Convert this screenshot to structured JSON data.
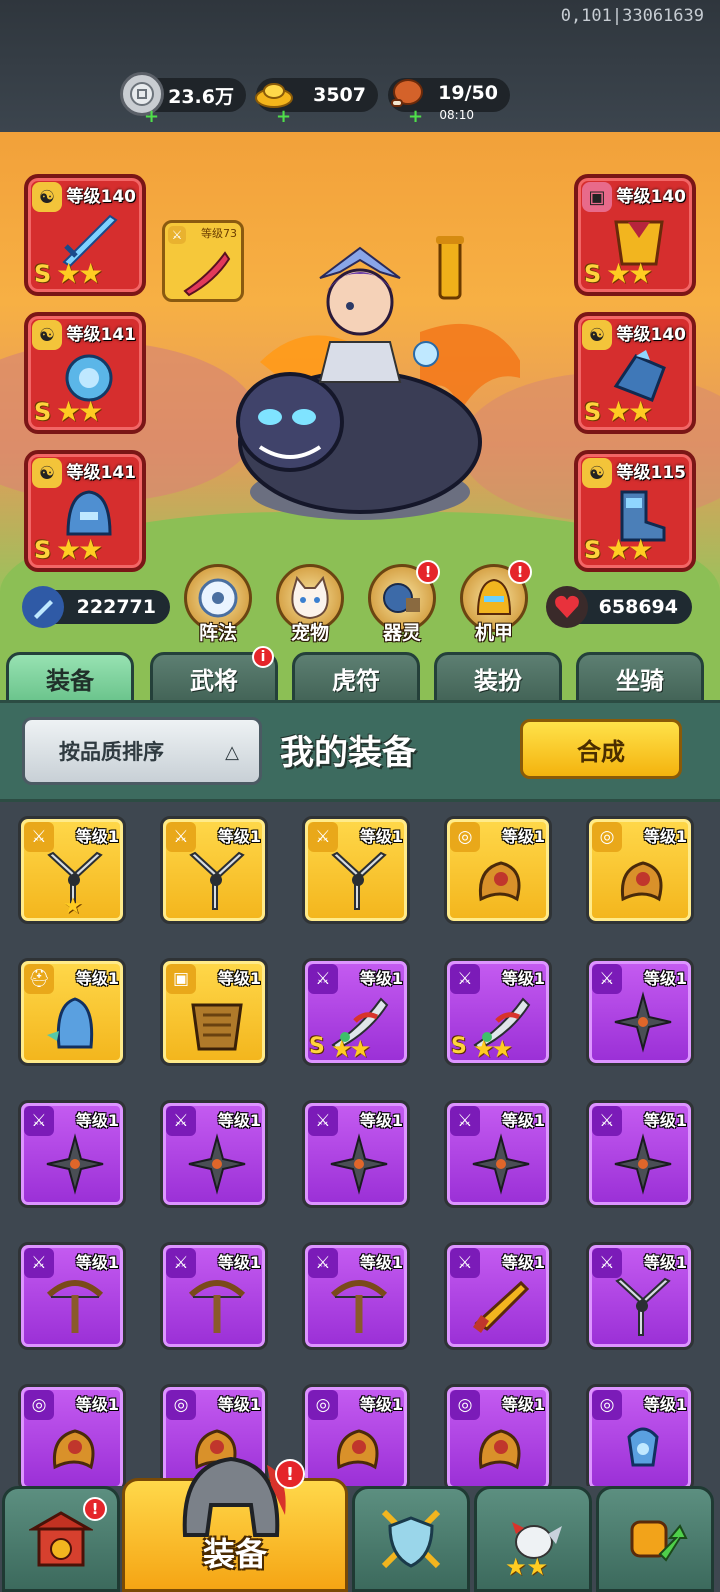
{
  "debug_id": "0,101|33061639",
  "resources": {
    "silver": {
      "value": "23.6万"
    },
    "gold": {
      "value": "3507"
    },
    "stamina": {
      "value": "19/50",
      "timer": "08:10"
    }
  },
  "hero_slots": {
    "left": [
      {
        "level": "等级140",
        "grade": "S",
        "stars": "★★"
      },
      {
        "level": "等级141",
        "grade": "S",
        "stars": "★★"
      },
      {
        "level": "等级141",
        "grade": "S",
        "stars": "★★"
      }
    ],
    "right": [
      {
        "level": "等级140",
        "grade": "S",
        "stars": "★★"
      },
      {
        "level": "等级140",
        "grade": "S",
        "stars": "★★"
      },
      {
        "level": "等级115",
        "grade": "S",
        "stars": "★★"
      }
    ],
    "linked_weapon": {
      "level": "等级73"
    }
  },
  "attack_power": "222771",
  "health_power": "658694",
  "features": [
    {
      "label": "阵法",
      "alert": false
    },
    {
      "label": "宠物",
      "alert": false
    },
    {
      "label": "器灵",
      "alert": true
    },
    {
      "label": "机甲",
      "alert": true
    }
  ],
  "tabs": [
    {
      "label": "装备",
      "active": true
    },
    {
      "label": "武将",
      "alert": true
    },
    {
      "label": "虎符"
    },
    {
      "label": "装扮"
    },
    {
      "label": "坐骑"
    }
  ],
  "panel": {
    "sort_label": "按品质排序",
    "title": "我的装备",
    "compose_label": "合成"
  },
  "inventory": [
    {
      "rarity": "gold",
      "type": "weapon",
      "item": "shuriken-blade",
      "level": "等级1",
      "stars": "★"
    },
    {
      "rarity": "gold",
      "type": "weapon",
      "item": "shuriken-blade",
      "level": "等级1"
    },
    {
      "rarity": "gold",
      "type": "weapon",
      "item": "shuriken-blade",
      "level": "等级1"
    },
    {
      "rarity": "gold",
      "type": "medal",
      "item": "amulet",
      "level": "等级1"
    },
    {
      "rarity": "gold",
      "type": "medal",
      "item": "amulet",
      "level": "等级1"
    },
    {
      "rarity": "gold",
      "type": "helmet",
      "item": "blue-helmet",
      "level": "等级1"
    },
    {
      "rarity": "gold",
      "type": "armor",
      "item": "bronze-armor",
      "level": "等级1"
    },
    {
      "rarity": "purple",
      "type": "weapon",
      "item": "dragon-blade",
      "level": "等级1",
      "grade": "S",
      "stars": "★★"
    },
    {
      "rarity": "purple",
      "type": "weapon",
      "item": "dragon-blade",
      "level": "等级1",
      "grade": "S",
      "stars": "★★"
    },
    {
      "rarity": "purple",
      "type": "weapon",
      "item": "ninja-star",
      "level": "等级1"
    },
    {
      "rarity": "purple",
      "type": "weapon",
      "item": "ninja-star",
      "level": "等级1"
    },
    {
      "rarity": "purple",
      "type": "weapon",
      "item": "ninja-star",
      "level": "等级1"
    },
    {
      "rarity": "purple",
      "type": "weapon",
      "item": "ninja-star",
      "level": "等级1"
    },
    {
      "rarity": "purple",
      "type": "weapon",
      "item": "ninja-star",
      "level": "等级1"
    },
    {
      "rarity": "purple",
      "type": "weapon",
      "item": "ninja-star",
      "level": "等级1"
    },
    {
      "rarity": "purple",
      "type": "weapon",
      "item": "crossbow",
      "level": "等级1"
    },
    {
      "rarity": "purple",
      "type": "weapon",
      "item": "crossbow",
      "level": "等级1"
    },
    {
      "rarity": "purple",
      "type": "weapon",
      "item": "crossbow",
      "level": "等级1"
    },
    {
      "rarity": "purple",
      "type": "weapon",
      "item": "golden-gun",
      "level": "等级1"
    },
    {
      "rarity": "purple",
      "type": "weapon",
      "item": "shuriken-blade",
      "level": "等级1"
    },
    {
      "rarity": "purple",
      "type": "medal",
      "item": "amulet",
      "level": "等级1"
    },
    {
      "rarity": "purple",
      "type": "medal",
      "item": "amulet",
      "level": "等级1"
    },
    {
      "rarity": "purple",
      "type": "medal",
      "item": "amulet",
      "level": "等级1"
    },
    {
      "rarity": "purple",
      "type": "medal",
      "item": "amulet",
      "level": "等级1"
    },
    {
      "rarity": "purple",
      "type": "medal",
      "item": "blue-amulet",
      "level": "等级1"
    }
  ],
  "bottom_nav": [
    {
      "icon": "gate-icon",
      "alert": true
    },
    {
      "label": "装备",
      "icon": "helmet-icon",
      "active": true,
      "alert": true
    },
    {
      "icon": "crossed-swords-shield-icon"
    },
    {
      "icon": "rooster-icon",
      "stars": "★★"
    },
    {
      "icon": "fist-upgrade-icon"
    }
  ],
  "colors": {
    "gold_rarity": "#f3b51c",
    "purple_rarity": "#9a2fd6",
    "hero_slot_red": "#d62e2e",
    "alert_red": "#e5252a",
    "tab_active": "#6bc48c"
  }
}
